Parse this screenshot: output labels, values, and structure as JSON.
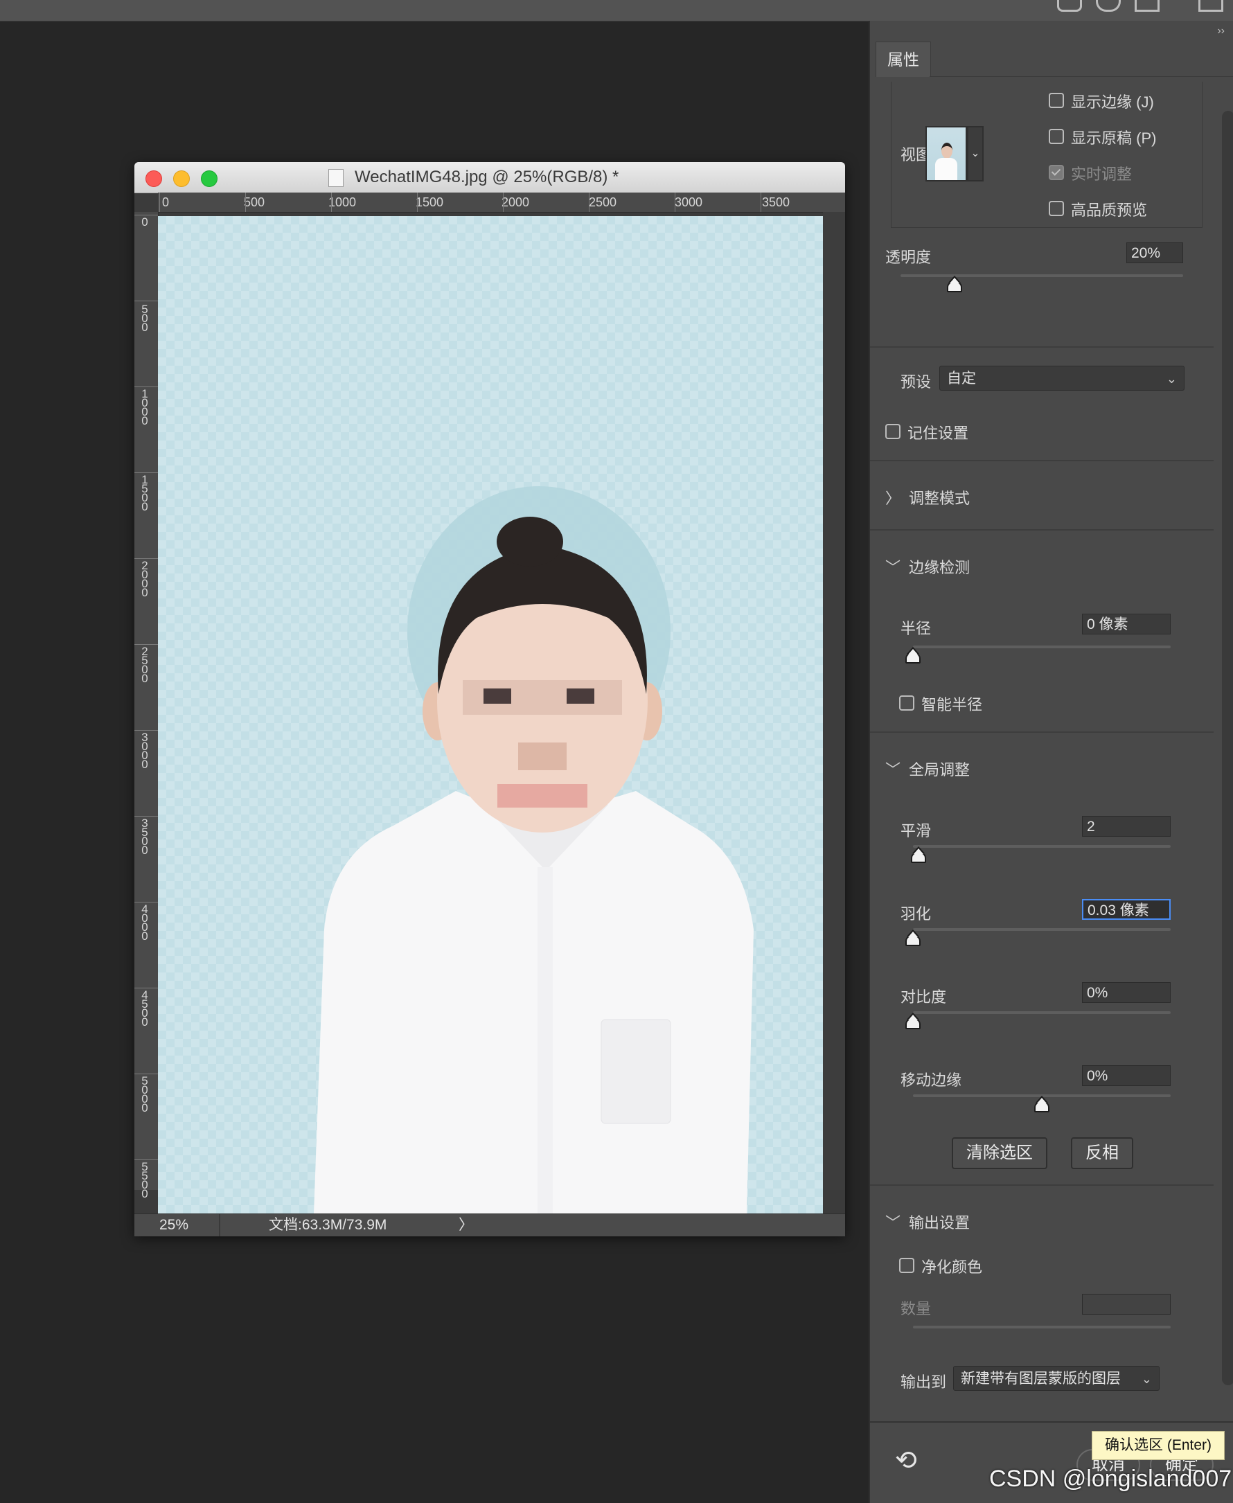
{
  "document_window": {
    "title": "WechatIMG48.jpg @ 25%(RGB/8) *",
    "ruler_top_labels": [
      "0",
      "500",
      "1000",
      "1500",
      "2000",
      "2500",
      "3000",
      "3500"
    ],
    "ruler_left_labels": [
      "0",
      "500",
      "1000",
      "1500",
      "2000",
      "2500",
      "3000",
      "3500",
      "4000",
      "4500",
      "5000",
      "5500"
    ],
    "status": {
      "zoom": "25%",
      "doc_info": "文档:63.3M/73.9M",
      "arrow": "〉"
    }
  },
  "properties_panel": {
    "tab_label": "属性",
    "collapse_glyph": "››",
    "view": {
      "label": "视图",
      "dropdown_glyph": "⌄",
      "options": [
        {
          "label": "显示边缘 (J)",
          "checked": false,
          "disabled": false
        },
        {
          "label": "显示原稿 (P)",
          "checked": false,
          "disabled": false
        },
        {
          "label": "实时调整",
          "checked": true,
          "disabled": true
        },
        {
          "label": "高品质预览",
          "checked": false,
          "disabled": false
        }
      ]
    },
    "opacity": {
      "label": "透明度",
      "value": "20%",
      "level_pct": 20
    },
    "preset": {
      "label": "预设",
      "value": "自定",
      "chevron": "⌄"
    },
    "remember": {
      "label": "记住设置",
      "checked": false
    },
    "adjust_mode": {
      "arrow": "〉",
      "label": "调整模式"
    },
    "edge_detection": {
      "arrow": "﹀",
      "label": "边缘检测",
      "radius": {
        "label": "半径",
        "value": "0 像素",
        "level_pct": 0
      },
      "smart_radius": {
        "label": "智能半径",
        "checked": false
      }
    },
    "global_adjust": {
      "arrow": "﹀",
      "label": "全局调整",
      "smooth": {
        "label": "平滑",
        "value": "2",
        "level_pct": 2
      },
      "feather": {
        "label": "羽化",
        "value": "0.03 像素",
        "level_pct": 0
      },
      "contrast": {
        "label": "对比度",
        "value": "0%",
        "level_pct": 0
      },
      "shift_edge": {
        "label": "移动边缘",
        "value": "0%",
        "level_pct": 50
      },
      "clear_button": "清除选区",
      "invert_button": "反相"
    },
    "output": {
      "arrow": "﹀",
      "label": "输出设置",
      "decontaminate": {
        "label": "净化颜色",
        "checked": false
      },
      "amount": {
        "label": "数量",
        "value": ""
      },
      "output_to": {
        "label": "输出到",
        "value": "新建带有图层蒙版的图层",
        "chevron": "⌄"
      }
    },
    "footer": {
      "reset_glyph": "⟲",
      "cancel": "取消",
      "ok": "确定"
    }
  },
  "tooltip": "确认选区 (Enter)",
  "watermark": "CSDN @longisland007",
  "colors": {
    "canvas_bg": "#c3dfe6",
    "panel_bg": "#494949",
    "app_bg": "#262626",
    "focus": "#4a8df5",
    "tooltip_bg": "#fdf7c5"
  }
}
